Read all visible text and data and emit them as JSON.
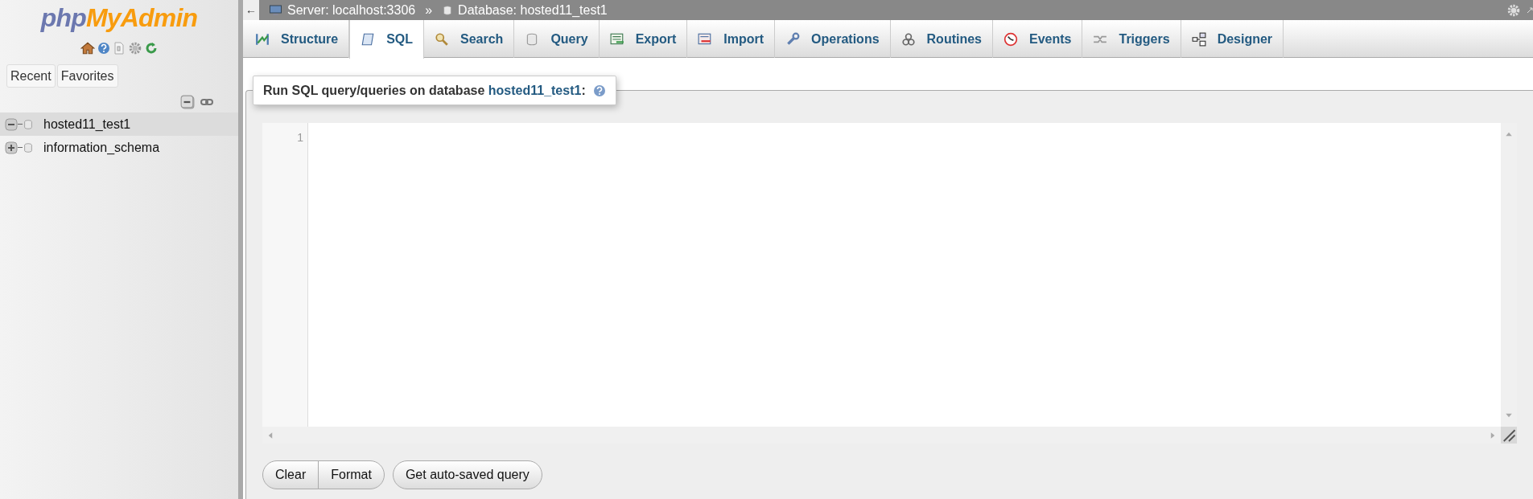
{
  "logo": {
    "part_1": "php",
    "part_2": "MyAdmin"
  },
  "sidebar": {
    "buttons": [
      "Recent",
      "Favorites"
    ],
    "tree": [
      {
        "label": "hosted11_test1",
        "expanded": true,
        "selected": true
      },
      {
        "label": "information_schema",
        "expanded": false,
        "selected": false
      }
    ]
  },
  "breadcrumb": {
    "back": "←",
    "server": "Server: localhost:3306",
    "separator": "»",
    "database": "Database: hosted11_test1"
  },
  "tabs": [
    {
      "label": "Structure",
      "selected": false
    },
    {
      "label": "SQL",
      "selected": true
    },
    {
      "label": "Search",
      "selected": false
    },
    {
      "label": "Query",
      "selected": false
    },
    {
      "label": "Export",
      "selected": false
    },
    {
      "label": "Import",
      "selected": false
    },
    {
      "label": "Operations",
      "selected": false
    },
    {
      "label": "Routines",
      "selected": false
    },
    {
      "label": "Events",
      "selected": false
    },
    {
      "label": "Triggers",
      "selected": false
    },
    {
      "label": "Designer",
      "selected": false
    }
  ],
  "sql_panel": {
    "legend": "Run SQL query/queries on database ",
    "database": "hosted11_test1",
    "legend_end": ":",
    "line_numbers": [
      "1"
    ],
    "button_groups": [
      [
        "Clear",
        "Format"
      ],
      [
        "Get auto-saved query"
      ]
    ]
  }
}
